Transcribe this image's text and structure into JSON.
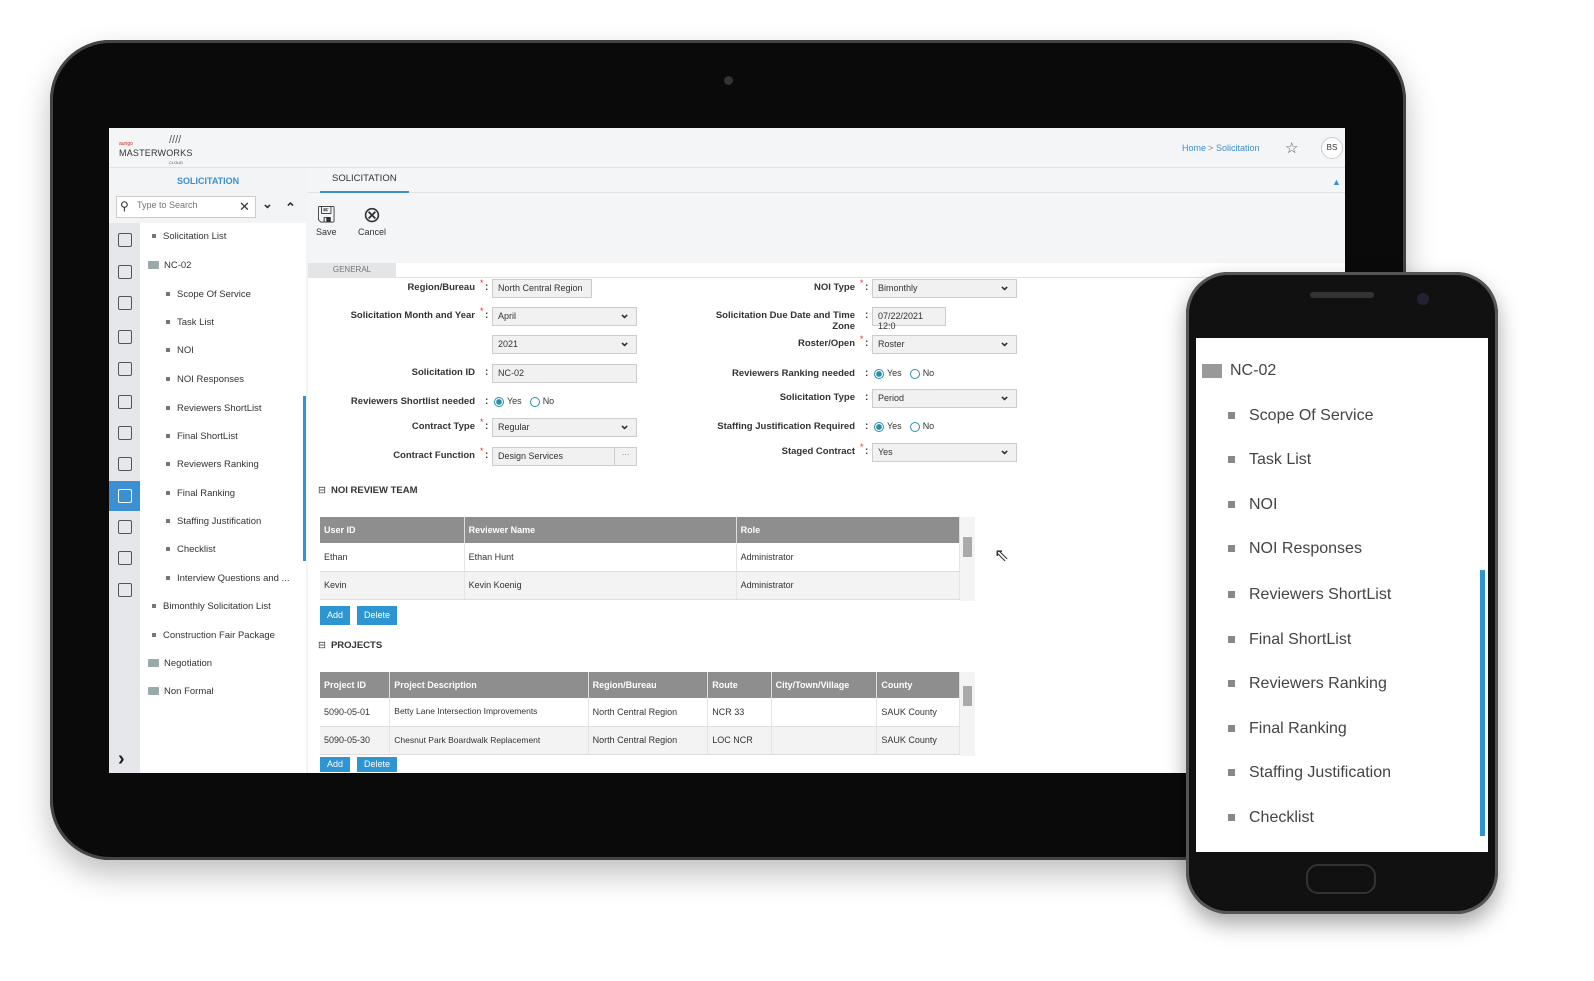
{
  "header": {
    "logo_brand": "aurigo",
    "logo_name": "MASTERWORKS",
    "logo_sub": "CLOUD",
    "breadcrumb_home": "Home",
    "breadcrumb_sep": ">",
    "breadcrumb_current": "Solicitation",
    "avatar": "BS"
  },
  "sidebar": {
    "title": "SOLICITATION",
    "search_placeholder": "Type to Search",
    "items": [
      {
        "label": "Solicitation List",
        "type": "leaf",
        "level": 1
      },
      {
        "label": "NC-02",
        "type": "folder",
        "level": 1
      },
      {
        "label": "Scope Of Service",
        "type": "leaf",
        "level": 2
      },
      {
        "label": "Task List",
        "type": "leaf",
        "level": 2
      },
      {
        "label": "NOI",
        "type": "leaf",
        "level": 2
      },
      {
        "label": "NOI Responses",
        "type": "leaf",
        "level": 2
      },
      {
        "label": "Reviewers ShortList",
        "type": "leaf",
        "level": 2
      },
      {
        "label": "Final ShortList",
        "type": "leaf",
        "level": 2
      },
      {
        "label": "Reviewers Ranking",
        "type": "leaf",
        "level": 2
      },
      {
        "label": "Final Ranking",
        "type": "leaf",
        "level": 2
      },
      {
        "label": "Staffing Justification",
        "type": "leaf",
        "level": 2
      },
      {
        "label": "Checklist",
        "type": "leaf",
        "level": 2
      },
      {
        "label": "Interview Questions and ...",
        "type": "leaf",
        "level": 2
      },
      {
        "label": "Bimonthly Solicitation List",
        "type": "leaf",
        "level": 1
      },
      {
        "label": "Construction Fair Package",
        "type": "leaf",
        "level": 1
      },
      {
        "label": "Negotiation",
        "type": "folder",
        "level": 1
      },
      {
        "label": "Non Formal",
        "type": "folder",
        "level": 1
      }
    ],
    "icons": [
      "home-icon",
      "money-doc-icon",
      "report-icon",
      "doc-search-icon",
      "building-icon",
      "document-icon",
      "flask-icon",
      "chart-icon",
      "edit-doc-icon",
      "map-pin-icon",
      "grid-icon",
      "gear-icon"
    ],
    "accent": "#3b8fd3"
  },
  "main": {
    "tab": "SOLICITATION",
    "save": "Save",
    "cancel": "Cancel",
    "subtab": "GENERAL",
    "form": {
      "region_label": "Region/Bureau",
      "region_value": "North Central Region",
      "month_label": "Solicitation Month and Year",
      "month_value": "April",
      "year_value": "2021",
      "id_label": "Solicitation ID",
      "id_value": "NC-02",
      "shortlist_label": "Reviewers Shortlist needed",
      "contract_type_label": "Contract Type",
      "contract_type_value": "Regular",
      "contract_function_label": "Contract Function",
      "contract_function_value": "Design Services",
      "ellipsis": "...",
      "noi_type_label": "NOI Type",
      "noi_type_value": "Bimonthly",
      "due_label": "Solicitation Due Date and Time Zone",
      "due_value": "07/22/2021 12:0",
      "roster_label": "Roster/Open",
      "roster_value": "Roster",
      "ranking_label": "Reviewers Ranking needed",
      "sol_type_label": "Solicitation Type",
      "sol_type_value": "Period",
      "staffing_label": "Staffing Justification Required",
      "staged_label": "Staged Contract",
      "staged_value": "Yes",
      "yes": "Yes",
      "no": "No",
      "colon": ":",
      "star": "*"
    },
    "noi_team": {
      "title": "NOI REVIEW TEAM",
      "columns": [
        "User ID",
        "Reviewer Name",
        "Role"
      ],
      "rows": [
        [
          "Ethan",
          "Ethan Hunt",
          "Administrator"
        ],
        [
          "Kevin",
          "Kevin Koenig",
          "Administrator"
        ]
      ],
      "add": "Add",
      "delete": "Delete"
    },
    "projects": {
      "title": "PROJECTS",
      "columns": [
        "Project ID",
        "Project Description",
        "Region/Bureau",
        "Route",
        "City/Town/Village",
        "County"
      ],
      "rows": [
        [
          "5090-05-01",
          "Betty Lane Intersection Improvements",
          "North Central Region",
          "NCR 33",
          "",
          "SAUK County"
        ],
        [
          "5090-05-30",
          "Chesnut Park Boardwalk Replacement",
          "North Central Region",
          "LOC NCR",
          "",
          "SAUK County"
        ]
      ],
      "add": "Add",
      "delete": "Delete"
    }
  },
  "phone": {
    "folder": "NC-02",
    "items": [
      "Scope Of Service",
      "Task List",
      "NOI",
      "NOI Responses",
      "Reviewers ShortList",
      "Final ShortList",
      "Reviewers Ranking",
      "Final Ranking",
      "Staffing Justification",
      "Checklist"
    ]
  }
}
